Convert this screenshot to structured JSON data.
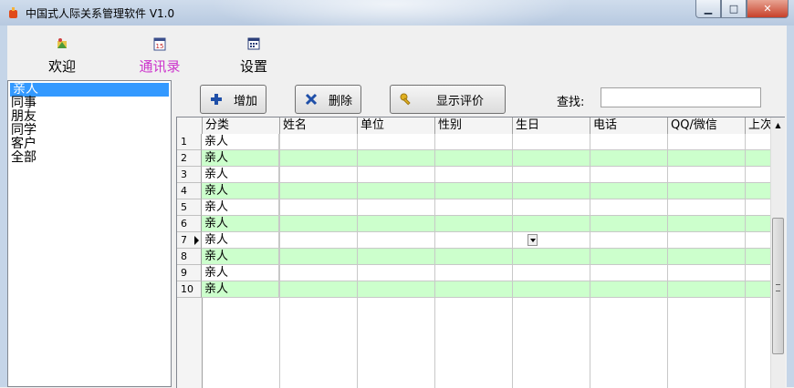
{
  "window": {
    "title": "中国式人际关系管理软件 V1.0",
    "min_glyph": "▁",
    "max_glyph": "□",
    "close_glyph": "✕"
  },
  "toolbar": {
    "items": [
      {
        "label": "欢迎",
        "icon": "welcome-icon"
      },
      {
        "label": "通讯录",
        "icon": "calendar-15-icon",
        "active": true
      },
      {
        "label": "设置",
        "icon": "calendar-grid-icon"
      }
    ]
  },
  "categories": [
    "亲人",
    "同事",
    "朋友",
    "同学",
    "客户",
    "全部"
  ],
  "actions": {
    "add_label": "增加",
    "delete_label": "删除",
    "review_label": "显示评价",
    "search_label": "查找:",
    "search_value": ""
  },
  "grid": {
    "columns": [
      "分类",
      "姓名",
      "单位",
      "性别",
      "生日",
      "电话",
      "QQ/微信",
      "上次"
    ],
    "rows": [
      {
        "num": "1",
        "category": "亲人"
      },
      {
        "num": "2",
        "category": "亲人"
      },
      {
        "num": "3",
        "category": "亲人"
      },
      {
        "num": "4",
        "category": "亲人"
      },
      {
        "num": "5",
        "category": "亲人"
      },
      {
        "num": "6",
        "category": "亲人"
      },
      {
        "num": "7",
        "category": "亲人",
        "current": true
      },
      {
        "num": "8",
        "category": "亲人"
      },
      {
        "num": "9",
        "category": "亲人"
      },
      {
        "num": "10",
        "category": "亲人"
      }
    ]
  },
  "colors": {
    "selection": "#3399ff",
    "active_tab": "#cc33cc",
    "alt_row": "#ccffcc"
  }
}
